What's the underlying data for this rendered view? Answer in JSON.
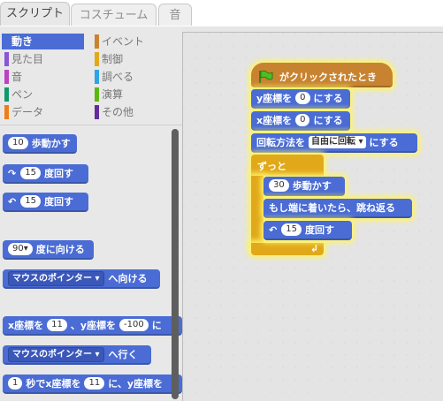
{
  "tabs": [
    "スクリプト",
    "コスチューム",
    "音"
  ],
  "categories": [
    {
      "label": "動き",
      "color": "#4a6cd4",
      "active": true
    },
    {
      "label": "イベント",
      "color": "#c88330"
    },
    {
      "label": "見た目",
      "color": "#8a55d7"
    },
    {
      "label": "制御",
      "color": "#e1a91a"
    },
    {
      "label": "音",
      "color": "#bb42c3"
    },
    {
      "label": "調べる",
      "color": "#2ca5e2"
    },
    {
      "label": "ペン",
      "color": "#0e9a6c"
    },
    {
      "label": "演算",
      "color": "#5cb712"
    },
    {
      "label": "データ",
      "color": "#ee7d16"
    },
    {
      "label": "その他",
      "color": "#632d99"
    }
  ],
  "palette": {
    "move": {
      "value": "10",
      "text": "歩動かす"
    },
    "turn_right": {
      "value": "15",
      "text": "度回す"
    },
    "turn_left": {
      "value": "15",
      "text": "度回す"
    },
    "point_dir": {
      "value": "90▾",
      "text": "度に向ける"
    },
    "point_towards": {
      "value": "マウスのポインター",
      "text": "へ向ける"
    },
    "set_xy": {
      "t1": "x座標を",
      "x": "11",
      "t2": "、y座標を",
      "y": "-100",
      "t3": "に"
    },
    "goto": {
      "value": "マウスのポインター",
      "text": "へ行く"
    },
    "glide": {
      "secs": "1",
      "t1": "秒でx座標を",
      "x": "11",
      "t2": "に、y座標を"
    }
  },
  "script": {
    "hat_text": "がクリックされたとき",
    "set_y": {
      "t1": "y座標を",
      "v": "0",
      "t2": "にする"
    },
    "set_x": {
      "t1": "x座標を",
      "v": "0",
      "t2": "にする"
    },
    "rotation": {
      "t1": "回転方法を",
      "v": "自由に回転",
      "t2": "にする"
    },
    "forever": "ずっと",
    "move": {
      "v": "30",
      "t": "歩動かす"
    },
    "bounce": "もし端に着いたら、跳ね返る",
    "turn": {
      "v": "15",
      "t": "度回す"
    }
  }
}
